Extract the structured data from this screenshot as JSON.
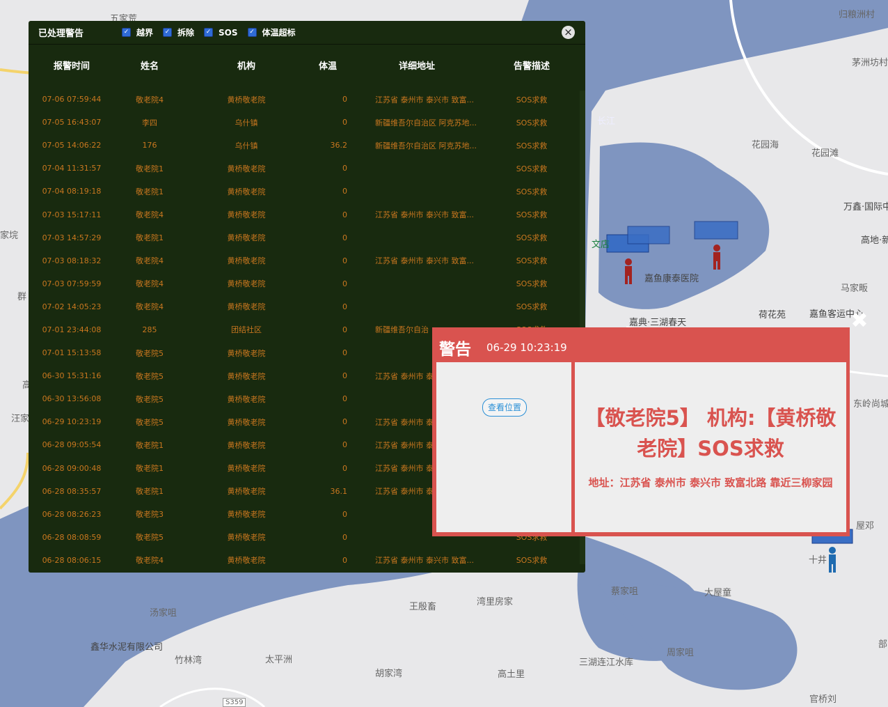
{
  "map_labels": [
    {
      "text": "五家荒"
    },
    {
      "text": "归粮洲村"
    },
    {
      "text": "茅洲坊村"
    },
    {
      "text": "长江"
    },
    {
      "text": "花园海"
    },
    {
      "text": "花园滩"
    },
    {
      "text": "万鑫·国际中"
    },
    {
      "text": "文店"
    },
    {
      "text": "高地·新"
    },
    {
      "text": "嘉鱼康泰医院"
    },
    {
      "text": "马家畈"
    },
    {
      "text": "荷花苑"
    },
    {
      "text": "嘉鱼客运中心"
    },
    {
      "text": "嘉典·三湖春天"
    },
    {
      "text": "东岭尚城"
    },
    {
      "text": "屋邓"
    },
    {
      "text": "十井"
    },
    {
      "text": "蔡家咀"
    },
    {
      "text": "大屋童"
    },
    {
      "text": "湾里房家"
    },
    {
      "text": "王殷畜"
    },
    {
      "text": "汤家咀"
    },
    {
      "text": "鑫华水泥有限公司"
    },
    {
      "text": "竹林湾"
    },
    {
      "text": "太平洲"
    },
    {
      "text": "胡家湾"
    },
    {
      "text": "高土里"
    },
    {
      "text": "三湖连江水库"
    },
    {
      "text": "周家咀"
    },
    {
      "text": "官桥刘"
    },
    {
      "text": "S359"
    },
    {
      "text": "家垸"
    },
    {
      "text": "群"
    },
    {
      "text": "汪家"
    },
    {
      "text": "高"
    },
    {
      "text": "部"
    }
  ],
  "panel": {
    "title": "已处理警告",
    "filters": [
      {
        "label": "越界",
        "checked": true
      },
      {
        "label": "拆除",
        "checked": true
      },
      {
        "label": "SOS",
        "checked": true
      },
      {
        "label": "体温超标",
        "checked": true
      }
    ],
    "close_icon": "×",
    "columns": [
      "报警时间",
      "姓名",
      "机构",
      "体温",
      "详细地址",
      "告警描述"
    ],
    "rows": [
      {
        "time": "07-06 07:59:44",
        "name": "敬老院4",
        "org": "黄桥敬老院",
        "temp": "0",
        "addr": "江苏省 泰州市 泰兴市 致富...",
        "desc": "SOS求救"
      },
      {
        "time": "07-05 16:43:07",
        "name": "李四",
        "org": "乌什镇",
        "temp": "0",
        "addr": "新疆维吾尔自治区 阿克苏地...",
        "desc": "SOS求救"
      },
      {
        "time": "07-05 14:06:22",
        "name": "176",
        "org": "乌什镇",
        "temp": "36.2",
        "addr": "新疆维吾尔自治区 阿克苏地...",
        "desc": "SOS求救"
      },
      {
        "time": "07-04 11:31:57",
        "name": "敬老院1",
        "org": "黄桥敬老院",
        "temp": "0",
        "addr": "",
        "desc": "SOS求救"
      },
      {
        "time": "07-04 08:19:18",
        "name": "敬老院1",
        "org": "黄桥敬老院",
        "temp": "0",
        "addr": "",
        "desc": "SOS求救"
      },
      {
        "time": "07-03 15:17:11",
        "name": "敬老院4",
        "org": "黄桥敬老院",
        "temp": "0",
        "addr": "江苏省 泰州市 泰兴市 致富...",
        "desc": "SOS求救"
      },
      {
        "time": "07-03 14:57:29",
        "name": "敬老院1",
        "org": "黄桥敬老院",
        "temp": "0",
        "addr": "",
        "desc": "SOS求救"
      },
      {
        "time": "07-03 08:18:32",
        "name": "敬老院4",
        "org": "黄桥敬老院",
        "temp": "0",
        "addr": "江苏省 泰州市 泰兴市 致富...",
        "desc": "SOS求救"
      },
      {
        "time": "07-03 07:59:59",
        "name": "敬老院4",
        "org": "黄桥敬老院",
        "temp": "0",
        "addr": "",
        "desc": "SOS求救"
      },
      {
        "time": "07-02 14:05:23",
        "name": "敬老院4",
        "org": "黄桥敬老院",
        "temp": "0",
        "addr": "",
        "desc": "SOS求救"
      },
      {
        "time": "07-01 23:44:08",
        "name": "285",
        "org": "团结社区",
        "temp": "0",
        "addr": "新疆维吾尔自治",
        "desc": "SOS求救"
      },
      {
        "time": "07-01 15:13:58",
        "name": "敬老院5",
        "org": "黄桥敬老院",
        "temp": "0",
        "addr": "",
        "desc": ""
      },
      {
        "time": "06-30 15:31:16",
        "name": "敬老院5",
        "org": "黄桥敬老院",
        "temp": "0",
        "addr": "江苏省 泰州市 泰",
        "desc": ""
      },
      {
        "time": "06-30 13:56:08",
        "name": "敬老院5",
        "org": "黄桥敬老院",
        "temp": "0",
        "addr": "",
        "desc": ""
      },
      {
        "time": "06-29 10:23:19",
        "name": "敬老院5",
        "org": "黄桥敬老院",
        "temp": "0",
        "addr": "江苏省 泰州市 泰",
        "desc": ""
      },
      {
        "time": "06-28 09:05:54",
        "name": "敬老院1",
        "org": "黄桥敬老院",
        "temp": "0",
        "addr": "江苏省 泰州市 泰",
        "desc": ""
      },
      {
        "time": "06-28 09:00:48",
        "name": "敬老院1",
        "org": "黄桥敬老院",
        "temp": "0",
        "addr": "江苏省 泰州市 泰",
        "desc": ""
      },
      {
        "time": "06-28 08:35:57",
        "name": "敬老院1",
        "org": "黄桥敬老院",
        "temp": "36.1",
        "addr": "江苏省 泰州市 泰",
        "desc": ""
      },
      {
        "time": "06-28 08:26:23",
        "name": "敬老院3",
        "org": "黄桥敬老院",
        "temp": "0",
        "addr": "",
        "desc": ""
      },
      {
        "time": "06-28 08:08:59",
        "name": "敬老院5",
        "org": "黄桥敬老院",
        "temp": "0",
        "addr": "",
        "desc": "SOS求救"
      },
      {
        "time": "06-28 08:06:15",
        "name": "敬老院4",
        "org": "黄桥敬老院",
        "temp": "0",
        "addr": "江苏省 泰州市 泰兴市 致富...",
        "desc": "SOS求救"
      }
    ]
  },
  "alert": {
    "title": "警告",
    "time": "06-29 10:23:19",
    "locate_button": "查看位置",
    "message": "【敬老院5】 机构:【黄桥敬老院】SOS求救",
    "address": "地址：江苏省 泰州市 泰兴市 致富北路 靠近三柳家园",
    "close_icon": "✖"
  },
  "colors": {
    "panel_bg": "#182a0f",
    "row_text": "#c9771f",
    "alert_red": "#d9534f",
    "water": "#7f95c0"
  }
}
